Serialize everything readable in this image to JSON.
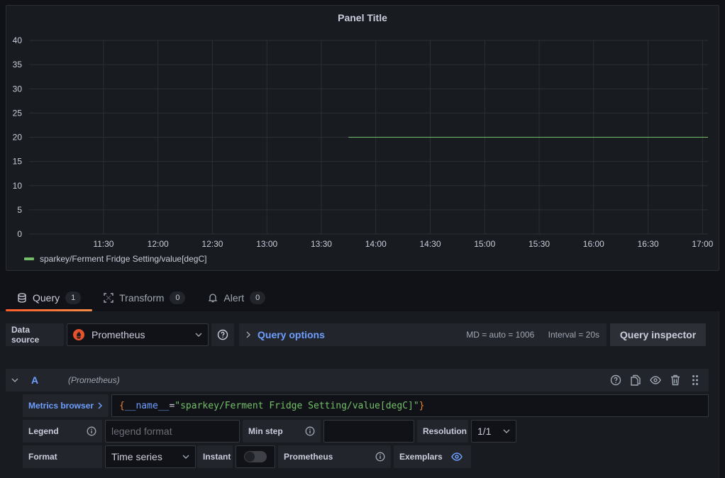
{
  "panel": {
    "title": "Panel Title"
  },
  "chart_data": {
    "type": "line",
    "title": "Panel Title",
    "xlabel": "",
    "ylabel": "",
    "ylim": [
      0,
      40
    ],
    "yticks": [
      0,
      5,
      10,
      15,
      20,
      25,
      30,
      35,
      40
    ],
    "xticks": [
      "11:30",
      "12:00",
      "12:30",
      "13:00",
      "13:30",
      "14:00",
      "14:30",
      "15:00",
      "15:30",
      "16:00",
      "16:30",
      "17:00"
    ],
    "xlim": [
      "10:49",
      "17:03"
    ],
    "grid": true,
    "legend_position": "bottom-left",
    "series": [
      {
        "name": "sparkey/Ferment Fridge Setting/value[degC]",
        "color": "#73bf69",
        "points": [
          {
            "x": "13:45",
            "y": 20
          },
          {
            "x": "17:03",
            "y": 20
          }
        ]
      }
    ]
  },
  "tabs": [
    {
      "label": "Query",
      "count": "1",
      "icon": "database-icon",
      "active": true
    },
    {
      "label": "Transform",
      "count": "0",
      "icon": "transform-icon",
      "active": false
    },
    {
      "label": "Alert",
      "count": "0",
      "icon": "bell-icon",
      "active": false
    }
  ],
  "datasource": {
    "label": "Data source",
    "value": "Prometheus",
    "brand_color": "#e6522c"
  },
  "query_options": {
    "title": "Query options",
    "md": "MD = auto = 1006",
    "interval": "Interval = 20s"
  },
  "query_inspector_label": "Query inspector",
  "query": {
    "letter": "A",
    "datasource": "(Prometheus)",
    "metrics_browser_label": "Metrics browser",
    "expr": {
      "open": "{",
      "label": "__name__",
      "op": "=",
      "value": "\"sparkey/Ferment Fridge Setting/value[degC]\"",
      "close": "}"
    },
    "legend_label": "Legend",
    "legend_placeholder": "legend format",
    "min_step_label": "Min step",
    "min_step_value": "",
    "resolution_label": "Resolution",
    "resolution_value": "1/1",
    "format_label": "Format",
    "format_value": "Time series",
    "instant_label": "Instant",
    "instant_on": false,
    "type_label": "Prometheus",
    "exemplars_label": "Exemplars",
    "exemplars_on": true
  },
  "colors": {
    "accent": "#6e9fff",
    "series": "#73bf69",
    "tab_underline": "#ff5e2b"
  }
}
